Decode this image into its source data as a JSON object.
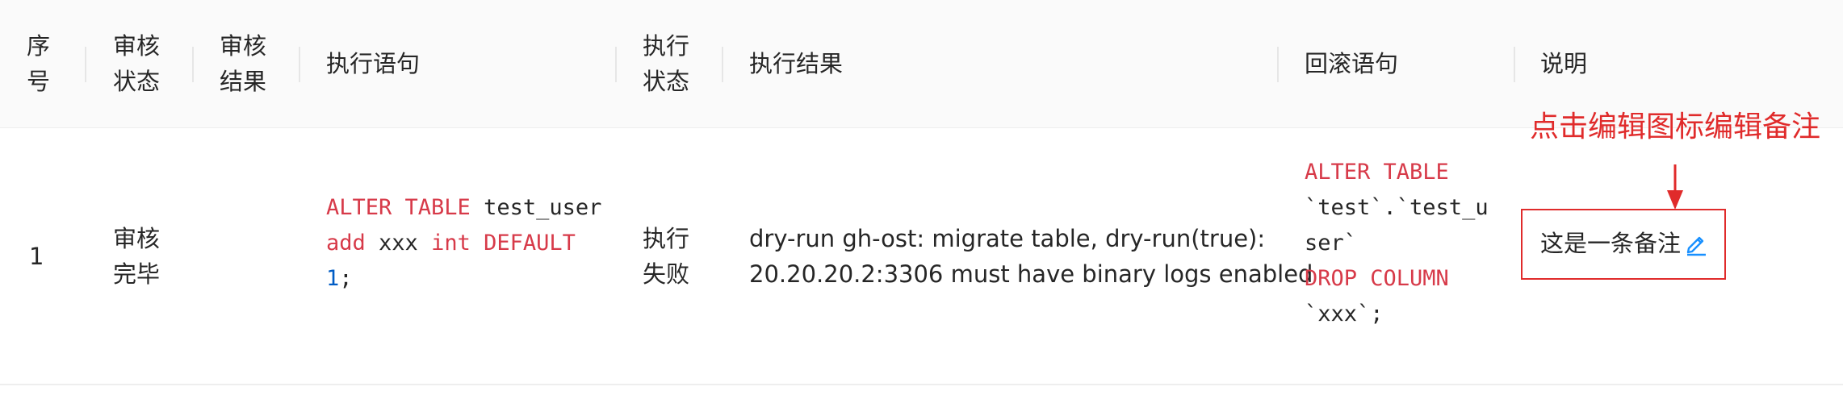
{
  "table": {
    "headers": {
      "index": [
        "序",
        "号"
      ],
      "audit_status": [
        "审核",
        "状态"
      ],
      "audit_result": [
        "审核",
        "结果"
      ],
      "sql": "执行语句",
      "exec_status": [
        "执行",
        "状态"
      ],
      "exec_result": "执行结果",
      "rollback_sql": "回滚语句",
      "description": "说明"
    },
    "row": {
      "index": "1",
      "audit_status": [
        "审核",
        "完毕"
      ],
      "audit_result": "",
      "sql": {
        "l1_kw": "ALTER TABLE",
        "l1_rest": " test_user",
        "l2_kw1": "add",
        "l2_mid": " xxx ",
        "l2_kw2": "int",
        "l2_sp": " ",
        "l2_kw3": "DEFAULT",
        "l3_num": "1",
        "l3_end": ";"
      },
      "exec_status": [
        "执行",
        "失败"
      ],
      "exec_result": [
        "dry-run gh-ost: migrate table, dry-run(true):",
        "20.20.20.2:3306 must have binary logs enabled"
      ],
      "rollback_sql": {
        "l1_kw": "ALTER TABLE",
        "l2": "`test`.`test_u",
        "l3": "ser`",
        "l4_kw": "DROP COLUMN",
        "l5": "`xxx`;"
      },
      "description": "这是一条备注"
    }
  },
  "annotation": "点击编辑图标编辑备注",
  "icons": {
    "edit": "edit-icon",
    "arrow": "arrow-down-icon"
  },
  "colors": {
    "keyword": "#d73a49",
    "number": "#005cc5",
    "link": "#1890ff",
    "annotation": "#e02b2b"
  }
}
